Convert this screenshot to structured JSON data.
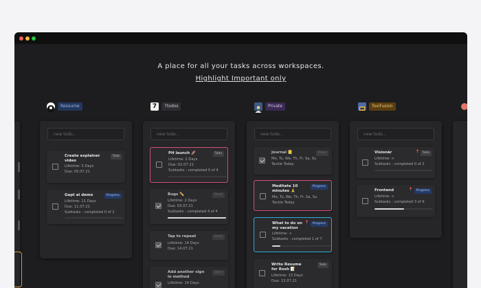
{
  "colors": {
    "pink": "#d2507a",
    "blue": "#2bb0d8",
    "progress": "#243a66",
    "todo": "#3e3e41"
  },
  "window": {
    "dots": [
      "#ff5f57",
      "#febc2e",
      "#28c840"
    ]
  },
  "hero": {
    "title": "A place for all your tasks across workspaces.",
    "link": "Highlight Important only"
  },
  "new_todo_placeholder": "new todo...",
  "workspaces": [
    {
      "name": "Resoume",
      "icon": "github-avatar-icon",
      "tasks": [
        {
          "title": "Create explainer video",
          "lines": [
            "Lifetime: 5 Days",
            "Due: 05.07.21"
          ],
          "badge": "Todo"
        },
        {
          "title": "Gapt ai demo",
          "lines": [
            "Lifetime: 11 Days",
            "Due: 11.07.21",
            "Subtasks - completed 0 of 2"
          ],
          "badge": "Progress",
          "progress": 0
        }
      ]
    },
    {
      "name": "7todos",
      "icon": "seven-logo-icon",
      "tasks": [
        {
          "title": "PH launch 🚀",
          "lines": [
            "Lifetime: 2 Days",
            "Due: 02.07.21",
            "Subtasks - completed 0 of 4"
          ],
          "badge": "Todo",
          "progress": 0
        },
        {
          "title": "Bugs ✏️",
          "lines": [
            "Lifetime: 2 Days",
            "Due: 03.07.21",
            "Subtasks - completed 4 of 4"
          ],
          "badge": "Done",
          "checked": true,
          "progress": 1
        },
        {
          "title": "Tap to repeat",
          "lines": [
            "Lifetime: 14 Days",
            "Due: 14.07.21"
          ],
          "badge": "Done",
          "checked": true
        },
        {
          "title": "Add another sign in method",
          "lines": [
            "Lifetime: 14 Days"
          ],
          "badge": "Done",
          "checked": true
        }
      ]
    },
    {
      "name": "Private",
      "icon": "person-avatar-icon",
      "tasks": [
        {
          "title": "Journal 📒",
          "lines": [
            "Mo, Tu, We, Th, Fr, Sa, Su",
            "Tackle Today"
          ],
          "badge": "Done",
          "checked": true
        },
        {
          "title": "Meditate 10 minutes 🙏",
          "lines": [
            "Mo, Tu, We, Th, Fr, Sa, Su",
            "Tackle Today"
          ],
          "badge": "Progress"
        },
        {
          "title": "What to do on my vacation",
          "lines": [
            "Lifetime: ∞",
            "Subtasks - completed 1 of 7"
          ],
          "badge": "Progress",
          "pinned": true,
          "progress": 0.14
        },
        {
          "title": "Write Resume for Rosh 📝",
          "lines": [
            "Lifetime: 13 Days",
            "Due: 13.07.21"
          ],
          "badge": "Todo"
        }
      ]
    },
    {
      "name": "ToxiFusion",
      "icon": "toxifusion-logo-icon",
      "tasks": [
        {
          "title": "Visionär",
          "lines": [
            "Lifetime: ∞",
            "Subtasks - completed 0 of 2"
          ],
          "badge": "Todo",
          "pinned": true,
          "progress": 0
        },
        {
          "title": "Frontend",
          "lines": [
            "Lifetime: ∞",
            "Subtasks - completed 3 of 6"
          ],
          "badge": "Progress",
          "pinned": true,
          "progress": 0.5
        }
      ]
    }
  ]
}
